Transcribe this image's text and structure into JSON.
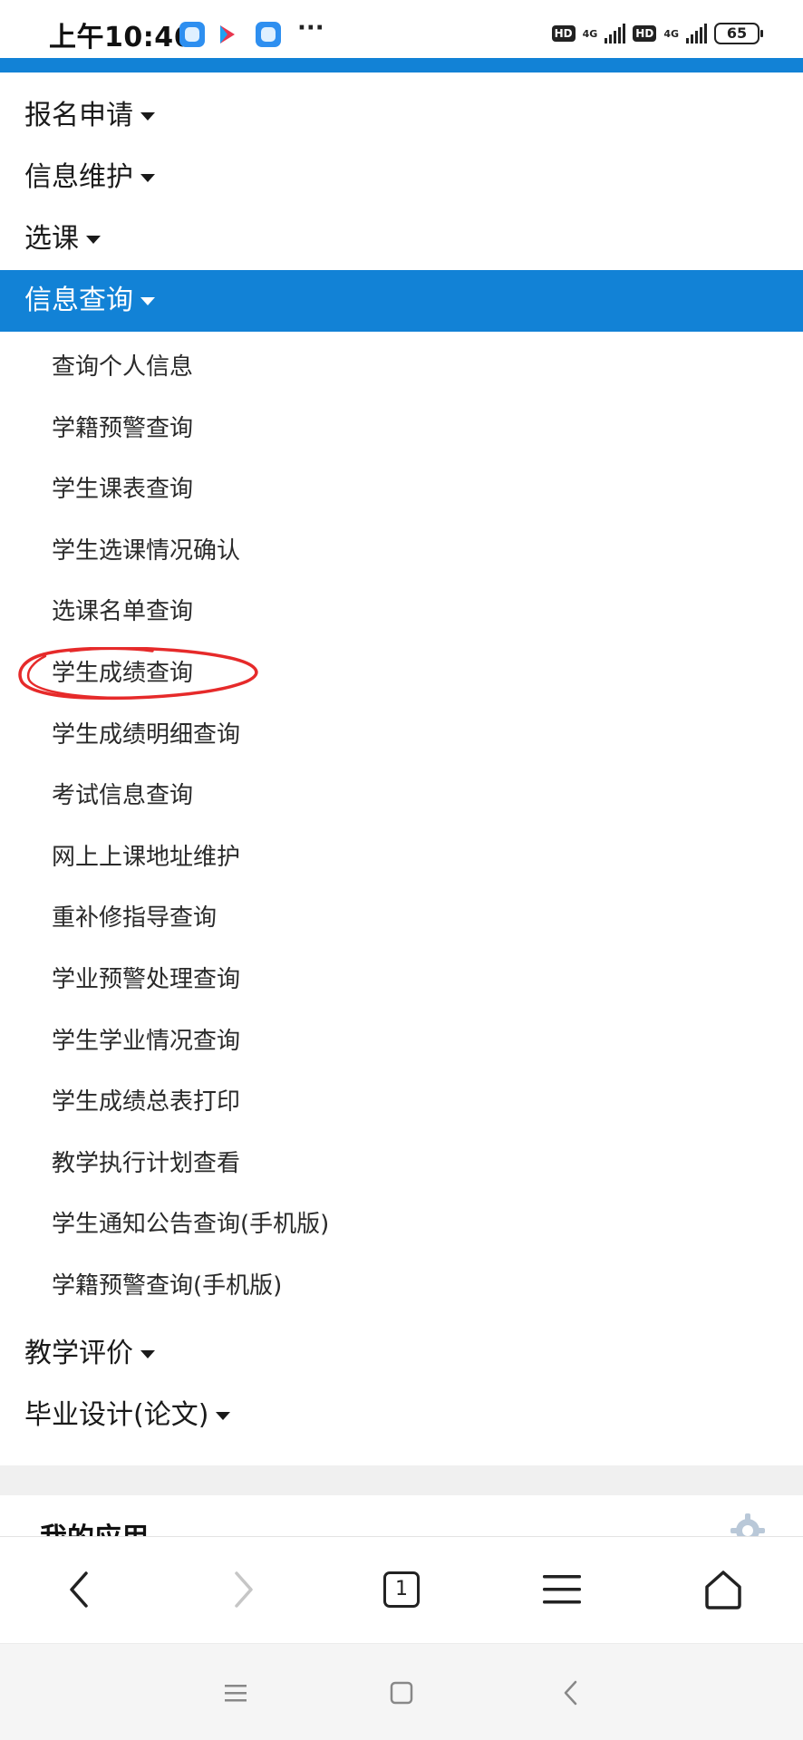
{
  "status_bar": {
    "time": "上午10:46",
    "more": "···",
    "hd_label": "HD",
    "network_label": "4G",
    "battery": "65"
  },
  "menu": {
    "items": [
      {
        "label": "报名申请"
      },
      {
        "label": "信息维护"
      },
      {
        "label": "选课"
      },
      {
        "label": "信息查询",
        "active": true
      }
    ],
    "submenu": [
      "查询个人信息",
      "学籍预警查询",
      "学生课表查询",
      "学生选课情况确认",
      "选课名单查询",
      "学生成绩查询",
      "学生成绩明细查询",
      "考试信息查询",
      "网上上课地址维护",
      "重补修指导查询",
      "学业预警处理查询",
      "学生学业情况查询",
      "学生成绩总表打印",
      "教学执行计划查看",
      "学生通知公告查询(手机版)",
      "学籍预警查询(手机版)"
    ],
    "highlighted_item": "学生成绩查询",
    "items_after": [
      {
        "label": "教学评价"
      },
      {
        "label": "毕业设计(论文)"
      }
    ]
  },
  "apps_section": {
    "title": "我的应用",
    "icon": "gear-icon"
  },
  "browser_bar": {
    "tab_count": "1",
    "icons": [
      "back-icon",
      "forward-icon",
      "tabs-icon",
      "menu-icon",
      "home-icon"
    ]
  },
  "colors": {
    "accent": "#1282d6",
    "highlight_ring": "#e62a2a"
  }
}
